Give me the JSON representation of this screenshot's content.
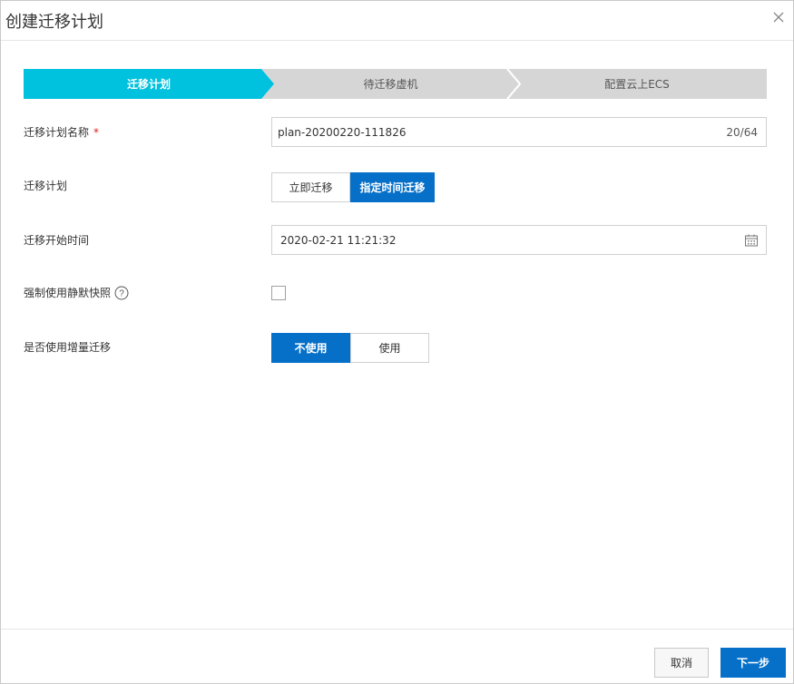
{
  "dialog": {
    "title": "创建迁移计划",
    "close_icon": "close-icon"
  },
  "steps": [
    {
      "label": "迁移计划",
      "active": true
    },
    {
      "label": "待迁移虚机",
      "active": false
    },
    {
      "label": "配置云上ECS",
      "active": false
    }
  ],
  "form": {
    "plan_name": {
      "label": "迁移计划名称",
      "required_mark": "*",
      "value": "plan-20200220-111826",
      "counter": "20/64"
    },
    "plan_type": {
      "label": "迁移计划",
      "options": [
        "立即迁移",
        "指定时间迁移"
      ],
      "selected": "指定时间迁移"
    },
    "start_time": {
      "label": "迁移开始时间",
      "value": "2020-02-21 11:21:32",
      "icon": "calendar-icon"
    },
    "force_snapshot": {
      "label": "强制使用静默快照",
      "checked": false,
      "icon": "help-icon"
    },
    "incremental": {
      "label": "是否使用增量迁移",
      "options": [
        "不使用",
        "使用"
      ],
      "selected": "不使用"
    }
  },
  "footer": {
    "cancel_label": "取消",
    "next_label": "下一步"
  },
  "colors": {
    "step_active": "#00c1de",
    "step_inactive": "#d6d6d6",
    "primary": "#0670c9",
    "required": "#e02020"
  }
}
